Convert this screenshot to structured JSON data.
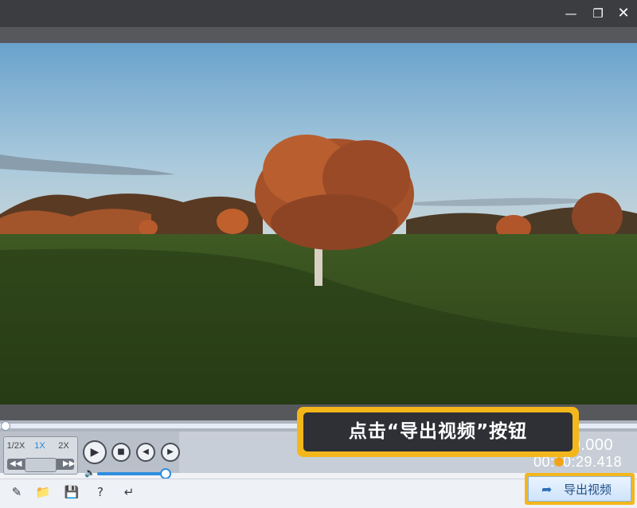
{
  "window": {
    "minimize_icon": "minimize-icon",
    "restore_icon": "restore-icon",
    "close_icon": "close-icon"
  },
  "video": {
    "scene": "autumn-tree-meadow"
  },
  "playback": {
    "speeds": [
      "1/2X",
      "1X",
      "2X"
    ],
    "selected_speed": "1X",
    "current_time": "00:00:00.000",
    "current_time_visible": "00.000",
    "total_time": "00:00:29.418",
    "total_time_visible": "00:00:29.418",
    "progress_fraction": 0,
    "volume_fraction": 1
  },
  "callout": {
    "text": "点击“导出视频”按钮"
  },
  "toolbar": {
    "icons": [
      "text-icon",
      "folder-icon",
      "save-icon",
      "help-icon",
      "share-icon"
    ],
    "export_label": "导出视频"
  },
  "colors": {
    "accent": "#f4b71b",
    "blue": "#2f8ee0",
    "titlebar": "#3c3d40"
  }
}
